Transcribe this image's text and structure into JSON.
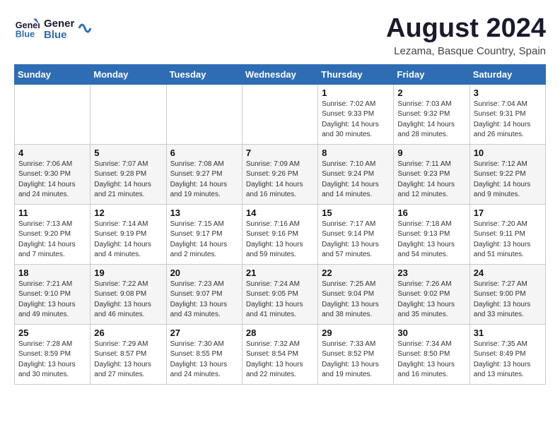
{
  "header": {
    "logo_line1": "General",
    "logo_line2": "Blue",
    "month_year": "August 2024",
    "location": "Lezama, Basque Country, Spain"
  },
  "days_of_week": [
    "Sunday",
    "Monday",
    "Tuesday",
    "Wednesday",
    "Thursday",
    "Friday",
    "Saturday"
  ],
  "weeks": [
    [
      {
        "day": "",
        "info": ""
      },
      {
        "day": "",
        "info": ""
      },
      {
        "day": "",
        "info": ""
      },
      {
        "day": "",
        "info": ""
      },
      {
        "day": "1",
        "info": "Sunrise: 7:02 AM\nSunset: 9:33 PM\nDaylight: 14 hours\nand 30 minutes."
      },
      {
        "day": "2",
        "info": "Sunrise: 7:03 AM\nSunset: 9:32 PM\nDaylight: 14 hours\nand 28 minutes."
      },
      {
        "day": "3",
        "info": "Sunrise: 7:04 AM\nSunset: 9:31 PM\nDaylight: 14 hours\nand 26 minutes."
      }
    ],
    [
      {
        "day": "4",
        "info": "Sunrise: 7:06 AM\nSunset: 9:30 PM\nDaylight: 14 hours\nand 24 minutes."
      },
      {
        "day": "5",
        "info": "Sunrise: 7:07 AM\nSunset: 9:28 PM\nDaylight: 14 hours\nand 21 minutes."
      },
      {
        "day": "6",
        "info": "Sunrise: 7:08 AM\nSunset: 9:27 PM\nDaylight: 14 hours\nand 19 minutes."
      },
      {
        "day": "7",
        "info": "Sunrise: 7:09 AM\nSunset: 9:26 PM\nDaylight: 14 hours\nand 16 minutes."
      },
      {
        "day": "8",
        "info": "Sunrise: 7:10 AM\nSunset: 9:24 PM\nDaylight: 14 hours\nand 14 minutes."
      },
      {
        "day": "9",
        "info": "Sunrise: 7:11 AM\nSunset: 9:23 PM\nDaylight: 14 hours\nand 12 minutes."
      },
      {
        "day": "10",
        "info": "Sunrise: 7:12 AM\nSunset: 9:22 PM\nDaylight: 14 hours\nand 9 minutes."
      }
    ],
    [
      {
        "day": "11",
        "info": "Sunrise: 7:13 AM\nSunset: 9:20 PM\nDaylight: 14 hours\nand 7 minutes."
      },
      {
        "day": "12",
        "info": "Sunrise: 7:14 AM\nSunset: 9:19 PM\nDaylight: 14 hours\nand 4 minutes."
      },
      {
        "day": "13",
        "info": "Sunrise: 7:15 AM\nSunset: 9:17 PM\nDaylight: 14 hours\nand 2 minutes."
      },
      {
        "day": "14",
        "info": "Sunrise: 7:16 AM\nSunset: 9:16 PM\nDaylight: 13 hours\nand 59 minutes."
      },
      {
        "day": "15",
        "info": "Sunrise: 7:17 AM\nSunset: 9:14 PM\nDaylight: 13 hours\nand 57 minutes."
      },
      {
        "day": "16",
        "info": "Sunrise: 7:18 AM\nSunset: 9:13 PM\nDaylight: 13 hours\nand 54 minutes."
      },
      {
        "day": "17",
        "info": "Sunrise: 7:20 AM\nSunset: 9:11 PM\nDaylight: 13 hours\nand 51 minutes."
      }
    ],
    [
      {
        "day": "18",
        "info": "Sunrise: 7:21 AM\nSunset: 9:10 PM\nDaylight: 13 hours\nand 49 minutes."
      },
      {
        "day": "19",
        "info": "Sunrise: 7:22 AM\nSunset: 9:08 PM\nDaylight: 13 hours\nand 46 minutes."
      },
      {
        "day": "20",
        "info": "Sunrise: 7:23 AM\nSunset: 9:07 PM\nDaylight: 13 hours\nand 43 minutes."
      },
      {
        "day": "21",
        "info": "Sunrise: 7:24 AM\nSunset: 9:05 PM\nDaylight: 13 hours\nand 41 minutes."
      },
      {
        "day": "22",
        "info": "Sunrise: 7:25 AM\nSunset: 9:04 PM\nDaylight: 13 hours\nand 38 minutes."
      },
      {
        "day": "23",
        "info": "Sunrise: 7:26 AM\nSunset: 9:02 PM\nDaylight: 13 hours\nand 35 minutes."
      },
      {
        "day": "24",
        "info": "Sunrise: 7:27 AM\nSunset: 9:00 PM\nDaylight: 13 hours\nand 33 minutes."
      }
    ],
    [
      {
        "day": "25",
        "info": "Sunrise: 7:28 AM\nSunset: 8:59 PM\nDaylight: 13 hours\nand 30 minutes."
      },
      {
        "day": "26",
        "info": "Sunrise: 7:29 AM\nSunset: 8:57 PM\nDaylight: 13 hours\nand 27 minutes."
      },
      {
        "day": "27",
        "info": "Sunrise: 7:30 AM\nSunset: 8:55 PM\nDaylight: 13 hours\nand 24 minutes."
      },
      {
        "day": "28",
        "info": "Sunrise: 7:32 AM\nSunset: 8:54 PM\nDaylight: 13 hours\nand 22 minutes."
      },
      {
        "day": "29",
        "info": "Sunrise: 7:33 AM\nSunset: 8:52 PM\nDaylight: 13 hours\nand 19 minutes."
      },
      {
        "day": "30",
        "info": "Sunrise: 7:34 AM\nSunset: 8:50 PM\nDaylight: 13 hours\nand 16 minutes."
      },
      {
        "day": "31",
        "info": "Sunrise: 7:35 AM\nSunset: 8:49 PM\nDaylight: 13 hours\nand 13 minutes."
      }
    ]
  ]
}
